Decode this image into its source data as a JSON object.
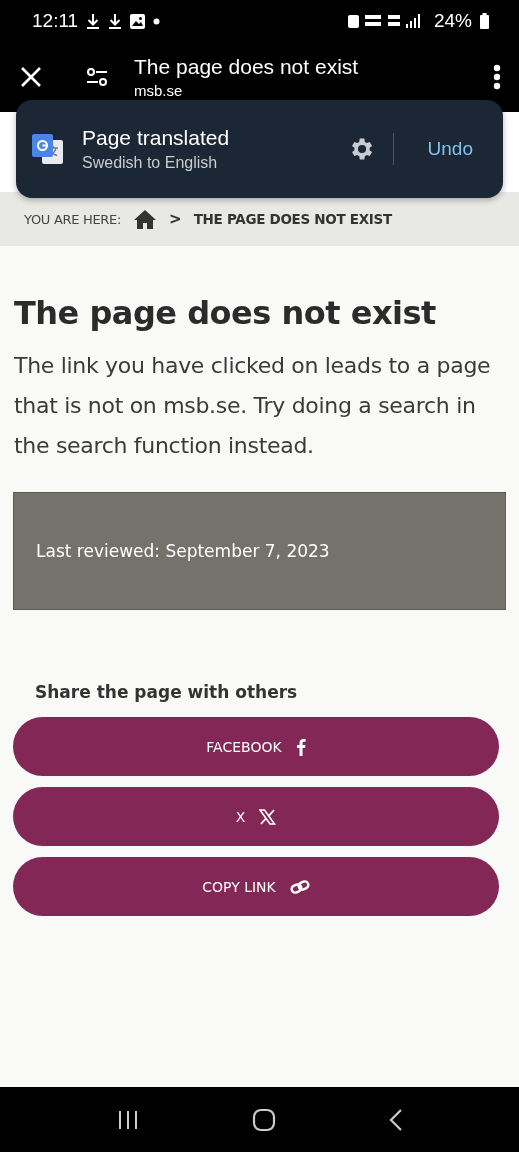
{
  "status_bar": {
    "time": "12:11",
    "battery": "24%"
  },
  "browser": {
    "title": "The page does not exist",
    "domain": "msb.se"
  },
  "toast": {
    "title": "Page translated",
    "subtitle": "Swedish to English",
    "action": "Undo"
  },
  "breadcrumb": {
    "label": "YOU ARE HERE:",
    "separator": ">",
    "current": "THE PAGE DOES NOT EXIST"
  },
  "page": {
    "heading": "The page does not exist",
    "body": "The link you have clicked on leads to a page that is not on msb.se. Try doing a search in the search function instead.",
    "reviewed": "Last reviewed: September 7, 2023"
  },
  "share": {
    "title": "Share the page with others",
    "buttons": [
      {
        "label": "FACEBOOK",
        "kind": "facebook"
      },
      {
        "label": "X",
        "kind": "x"
      },
      {
        "label": "COPY LINK",
        "kind": "link"
      }
    ]
  }
}
